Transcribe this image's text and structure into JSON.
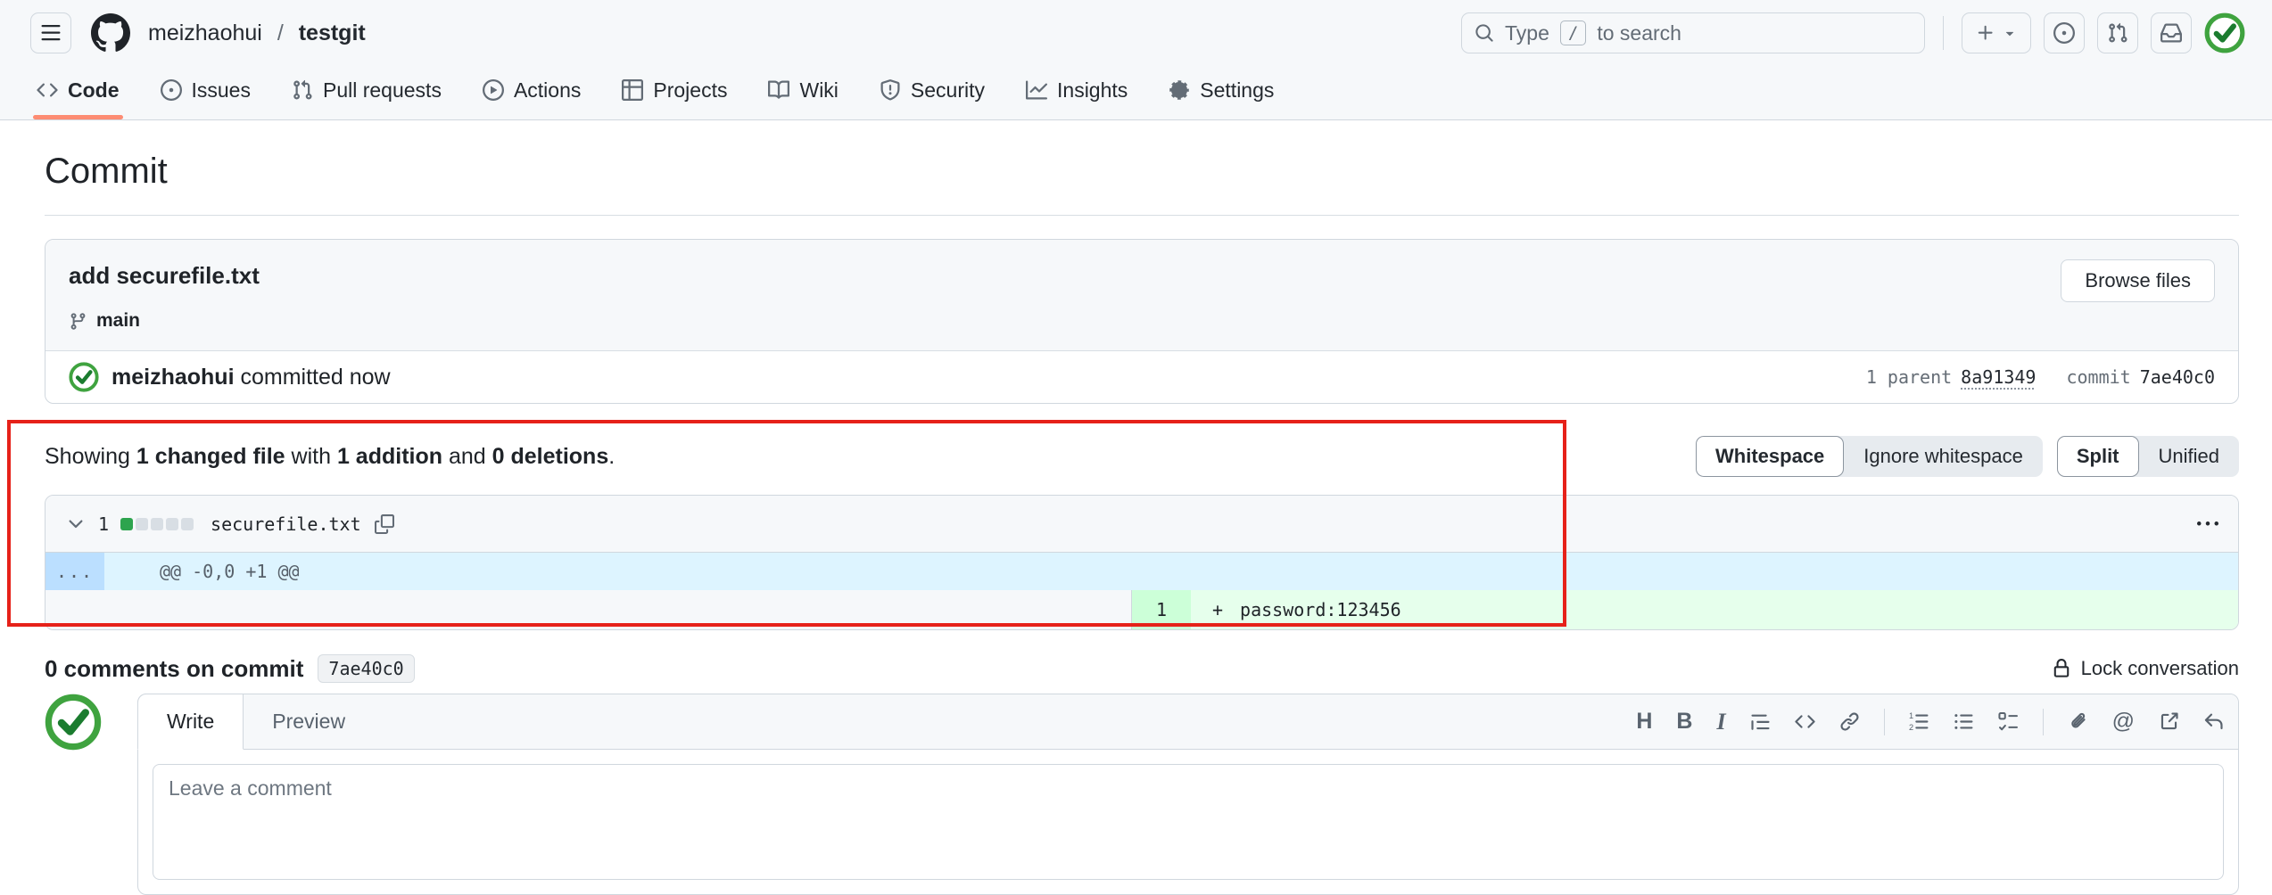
{
  "header": {
    "breadcrumb": {
      "owner": "meizhaohui",
      "separator": "/",
      "repo": "testgit"
    },
    "search": {
      "prefix": "Type",
      "key": "/",
      "suffix": "to search"
    },
    "nav_tabs": [
      {
        "label": "Code",
        "icon": "code-icon",
        "active": true
      },
      {
        "label": "Issues",
        "icon": "issue-opened-icon",
        "active": false
      },
      {
        "label": "Pull requests",
        "icon": "git-pull-request-icon",
        "active": false
      },
      {
        "label": "Actions",
        "icon": "play-icon",
        "active": false
      },
      {
        "label": "Projects",
        "icon": "table-icon",
        "active": false
      },
      {
        "label": "Wiki",
        "icon": "book-icon",
        "active": false
      },
      {
        "label": "Security",
        "icon": "shield-icon",
        "active": false
      },
      {
        "label": "Insights",
        "icon": "graph-icon",
        "active": false
      },
      {
        "label": "Settings",
        "icon": "gear-icon",
        "active": false
      }
    ]
  },
  "page": {
    "title": "Commit"
  },
  "commit": {
    "message": "add securefile.txt",
    "browse_label": "Browse files",
    "branch": "main",
    "author": "meizhaohui",
    "committed": "committed now",
    "parent_label": "1 parent",
    "parent_sha": "8a91349",
    "commit_label": "commit",
    "commit_sha": "7ae40c0"
  },
  "diffbar": {
    "showing": "Showing",
    "changed": "1 changed file",
    "with_word": "with",
    "addition": "1 addition",
    "and_word": "and",
    "deletions": "0 deletions",
    "period": ".",
    "whitespace": "Whitespace",
    "ignore_whitespace": "Ignore whitespace",
    "split": "Split",
    "unified": "Unified"
  },
  "file": {
    "changes_count": "1",
    "diffstat": {
      "added_blocks": 1,
      "neutral_blocks": 4
    },
    "name": "securefile.txt",
    "hunk_gutter": "...",
    "hunk_header": "@@ -0,0 +1 @@",
    "added_line_number": "1",
    "added_sign": "+",
    "added_code": "password:123456"
  },
  "comments": {
    "title": "0 comments on commit",
    "sha_chip": "7ae40c0",
    "lock_label": "Lock conversation",
    "write_tab": "Write",
    "preview_tab": "Preview",
    "placeholder": "Leave a comment"
  },
  "comment_toolbar": {
    "heading_glyph": "H",
    "bold_glyph": "B",
    "italic_glyph": "I",
    "mention_glyph": "@",
    "icons": [
      "heading",
      "bold",
      "italic",
      "quote",
      "code",
      "link",
      "numbered-list",
      "unordered-list",
      "tasklist",
      "paperclip",
      "mention",
      "cross-reference",
      "reply"
    ]
  },
  "colors": {
    "header_bg": "#f6f8fa",
    "border": "#d0d7de",
    "tab_underline_accent": "#fd8c73",
    "annotation_red": "#e62119",
    "hunk_gutter_bg": "#bbdfff",
    "hunk_bg": "#ddf4ff",
    "added_line_bg": "#e6ffec",
    "added_number_bg": "#ccffd8",
    "diffstat_green": "#2da44e",
    "avatar_check_green": "#3fa33f"
  }
}
